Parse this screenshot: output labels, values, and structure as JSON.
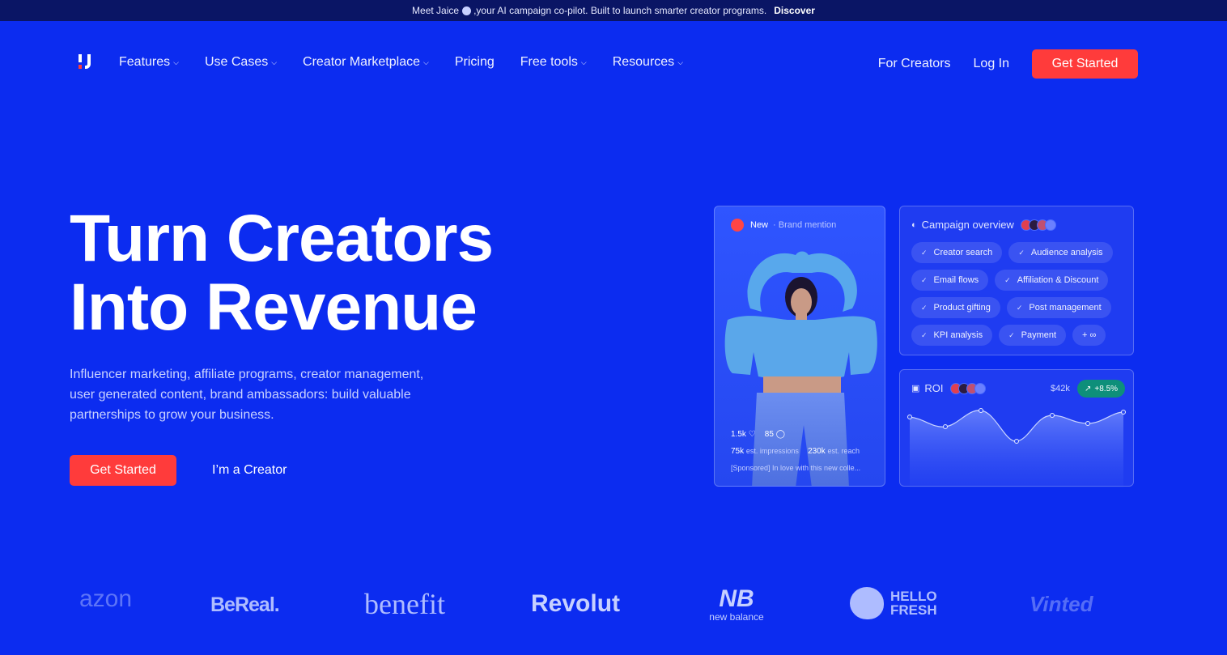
{
  "banner": {
    "text_before": "Meet Jaice",
    "text_after": ",your AI campaign co-pilot. Built to launch smarter creator programs.",
    "link": "Discover"
  },
  "nav": {
    "items": [
      {
        "label": "Features",
        "has_dropdown": true
      },
      {
        "label": "Use Cases",
        "has_dropdown": true
      },
      {
        "label": "Creator Marketplace",
        "has_dropdown": true
      },
      {
        "label": "Pricing",
        "has_dropdown": false
      },
      {
        "label": "Free tools",
        "has_dropdown": true
      },
      {
        "label": "Resources",
        "has_dropdown": true
      }
    ],
    "for_creators": "For Creators",
    "login": "Log In",
    "cta": "Get Started"
  },
  "hero": {
    "title_line1": "Turn Creators",
    "title_line2": "Into Revenue",
    "subtitle": "Influencer marketing, affiliate programs, creator management, user generated content, brand ambassadors: build valuable partnerships to grow your business.",
    "cta_primary": "Get Started",
    "cta_secondary": "I’m a Creator"
  },
  "post_card": {
    "tag": "New",
    "tag_sub": "Brand mention",
    "likes": "1.5k",
    "comments": "85",
    "impressions": "75k",
    "impressions_label": "est. impressions",
    "reach": "230k",
    "reach_label": "est. reach",
    "caption": "[Sponsored] In love with this new colle..."
  },
  "campaign_card": {
    "title": "Campaign overview",
    "pills": [
      "Creator search",
      "Audience analysis",
      "Email flows",
      "Affiliation & Discount",
      "Product gifting",
      "Post management",
      "KPI analysis",
      "Payment",
      "+ ∞"
    ]
  },
  "roi_card": {
    "title": "ROI",
    "amount": "$42k",
    "badge": "+8.5%"
  },
  "brands": [
    "azon",
    "BeReal.",
    "benefit",
    "Revolut",
    "new balance",
    "HELLO FRESH",
    "Vinted"
  ],
  "colors": {
    "background": "#0c2cf0",
    "banner": "#0a1565",
    "accent_red": "#ff3b3b",
    "badge_green": "#0e8f7a"
  }
}
